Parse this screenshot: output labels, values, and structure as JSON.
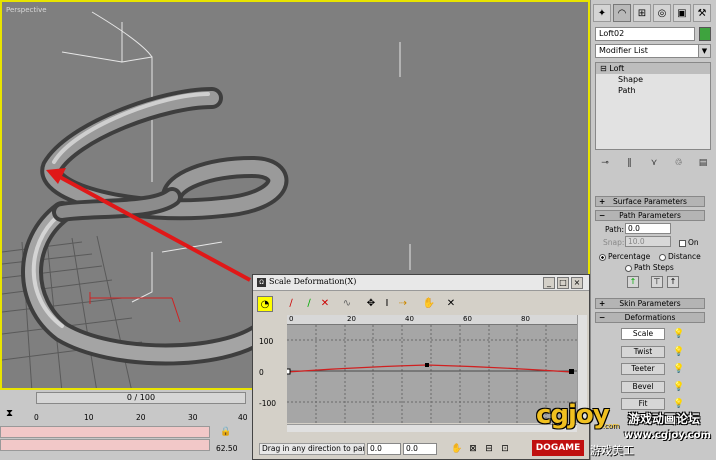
{
  "viewport": {
    "label": "Perspective"
  },
  "command_panel": {
    "object_name": "Loft02",
    "modifier_list": "Modifier List",
    "stack": {
      "root": "Loft",
      "children": [
        "Shape",
        "Path"
      ]
    },
    "rollouts": {
      "surface": "Surface Parameters",
      "path": "Path Parameters",
      "skin": "Skin Parameters",
      "deform": "Deformations"
    },
    "path_params": {
      "path_label": "Path:",
      "path_value": "0.0",
      "snap_label": "Snap:",
      "snap_value": "10.0",
      "on_label": "On",
      "percentage_label": "Percentage",
      "distance_label": "Distance",
      "path_steps_label": "Path Steps"
    },
    "deformations": [
      "Scale",
      "Twist",
      "Teeter",
      "Bevel",
      "Fit"
    ]
  },
  "timeline": {
    "frame_display": "0 / 100",
    "ticks": [
      "0",
      "10",
      "20",
      "30",
      "40"
    ],
    "coord_value": "62.50"
  },
  "dialog": {
    "title": "Scale Deformation(X)",
    "ruler_ticks": [
      "0",
      "20",
      "40",
      "60",
      "80"
    ],
    "y_labels": [
      "100",
      "0",
      "-100"
    ],
    "status_text": "Drag in any direction to pan Ec",
    "field1": "0.0",
    "field2": "0.0"
  },
  "watermark": {
    "logo": "cgjoy",
    "com": ".com",
    "cn_title": "游戏动画论坛",
    "url": "www.cgjoy.com",
    "dogame": "DOGAME",
    "cn_sub": "游戏美工"
  }
}
